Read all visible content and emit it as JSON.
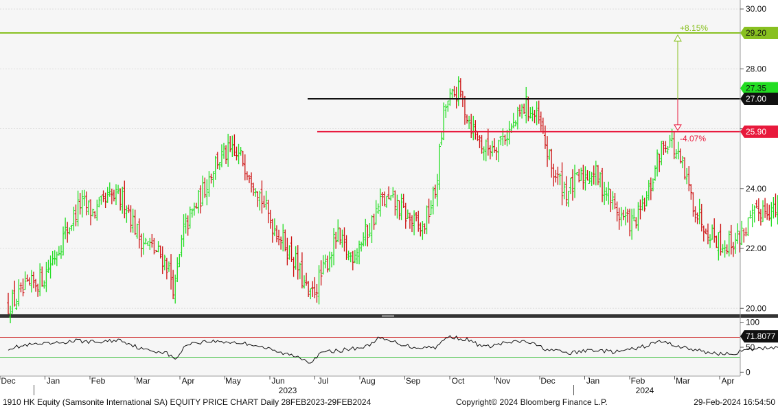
{
  "footer": {
    "left": "1910 HK Equity (Samsonite International SA) EQUITY PRICE CHART  Daily 28FEB2023-29FEB2024",
    "center": "Copyright© 2024 Bloomberg Finance L.P.",
    "right": "29-Feb-2024 16:54:50"
  },
  "colors": {
    "up": "#22dd22",
    "down": "#cc1111",
    "resistance": "#111111",
    "support": "#e8193c",
    "target": "#88c020",
    "rsi_line": "#111111",
    "rsi_upper": "#cc2222",
    "rsi_lower": "#33bb33"
  },
  "chart_data": [
    {
      "type": "candlestick",
      "title": "",
      "ylim": [
        19.8,
        30.3
      ],
      "yticks": [
        20,
        22,
        24,
        26,
        28,
        30
      ],
      "ytick_labels": [
        "20.00",
        "22.00",
        "24.00",
        "26.00",
        "28.00",
        "30.00"
      ],
      "x_month_labels": [
        "Dec",
        "Jan",
        "Feb",
        "Mar",
        "Apr",
        "May",
        "Jun",
        "Jul",
        "Aug",
        "Sep",
        "Oct",
        "Nov",
        "Dec",
        "Jan",
        "Feb",
        "Mar",
        "Apr"
      ],
      "x_year_labels": [
        "2023",
        "2024"
      ],
      "price_path": [
        {
          "m": 0.0,
          "p": 20.1
        },
        {
          "m": 0.4,
          "p": 20.6
        },
        {
          "m": 0.8,
          "p": 21.1
        },
        {
          "m": 1.2,
          "p": 22.3
        },
        {
          "m": 1.6,
          "p": 23.5
        },
        {
          "m": 1.9,
          "p": 23.2
        },
        {
          "m": 2.3,
          "p": 23.7
        },
        {
          "m": 2.6,
          "p": 23.6
        },
        {
          "m": 2.9,
          "p": 22.4
        },
        {
          "m": 3.2,
          "p": 22.0
        },
        {
          "m": 3.5,
          "p": 21.6
        },
        {
          "m": 3.7,
          "p": 20.6
        },
        {
          "m": 3.9,
          "p": 22.6
        },
        {
          "m": 4.3,
          "p": 23.8
        },
        {
          "m": 4.6,
          "p": 24.9
        },
        {
          "m": 4.9,
          "p": 25.2
        },
        {
          "m": 5.2,
          "p": 25.0
        },
        {
          "m": 5.5,
          "p": 24.2
        },
        {
          "m": 5.8,
          "p": 23.0
        },
        {
          "m": 6.1,
          "p": 22.3
        },
        {
          "m": 6.4,
          "p": 21.5
        },
        {
          "m": 6.7,
          "p": 20.3
        },
        {
          "m": 7.0,
          "p": 21.2
        },
        {
          "m": 7.3,
          "p": 22.4
        },
        {
          "m": 7.6,
          "p": 21.7
        },
        {
          "m": 8.0,
          "p": 22.6
        },
        {
          "m": 8.3,
          "p": 23.6
        },
        {
          "m": 8.6,
          "p": 23.5
        },
        {
          "m": 8.9,
          "p": 23.0
        },
        {
          "m": 9.2,
          "p": 22.6
        },
        {
          "m": 9.5,
          "p": 23.9
        },
        {
          "m": 9.7,
          "p": 26.7
        },
        {
          "m": 10.0,
          "p": 27.3
        },
        {
          "m": 10.3,
          "p": 26.1
        },
        {
          "m": 10.6,
          "p": 25.3
        },
        {
          "m": 10.9,
          "p": 25.6
        },
        {
          "m": 11.2,
          "p": 26.0
        },
        {
          "m": 11.5,
          "p": 26.8
        },
        {
          "m": 11.8,
          "p": 26.2
        },
        {
          "m": 12.1,
          "p": 24.6
        },
        {
          "m": 12.4,
          "p": 23.9
        },
        {
          "m": 12.7,
          "p": 24.3
        },
        {
          "m": 13.0,
          "p": 24.6
        },
        {
          "m": 13.3,
          "p": 23.9
        },
        {
          "m": 13.6,
          "p": 23.1
        },
        {
          "m": 13.9,
          "p": 22.8
        },
        {
          "m": 14.2,
          "p": 23.6
        },
        {
          "m": 14.5,
          "p": 25.3
        },
        {
          "m": 14.7,
          "p": 25.7
        },
        {
          "m": 15.0,
          "p": 24.6
        },
        {
          "m": 15.3,
          "p": 23.2
        },
        {
          "m": 15.6,
          "p": 22.6
        },
        {
          "m": 15.9,
          "p": 22.1
        },
        {
          "m": 16.2,
          "p": 22.3
        },
        {
          "m": 16.5,
          "p": 22.9
        },
        {
          "m": 16.8,
          "p": 23.4
        },
        {
          "m": 17.1,
          "p": 23.2
        },
        {
          "m": 17.4,
          "p": 23.7
        },
        {
          "m": 17.6,
          "p": 23.2
        },
        {
          "m": 17.85,
          "p": 27.35
        }
      ],
      "last_price": 27.35,
      "last_price_label": "27.35",
      "levels": [
        {
          "name": "target",
          "value": 29.2,
          "label": "29.20",
          "change_label": "+8.15%"
        },
        {
          "name": "resistance",
          "value": 27.0,
          "label": "27.00"
        },
        {
          "name": "support",
          "value": 25.9,
          "label": "25.90",
          "change_label": "-4.07%"
        }
      ]
    },
    {
      "type": "line",
      "title": "",
      "ylim": [
        -5,
        105
      ],
      "yticks": [
        0,
        50,
        100
      ],
      "ytick_labels": [
        "0",
        "50",
        "100"
      ],
      "upper_band": 70,
      "lower_band": 30,
      "last_value_label": "71.8077",
      "values_path": [
        {
          "m": 0.0,
          "v": 48
        },
        {
          "m": 0.5,
          "v": 55
        },
        {
          "m": 1.0,
          "v": 57
        },
        {
          "m": 1.5,
          "v": 63
        },
        {
          "m": 2.0,
          "v": 60
        },
        {
          "m": 2.5,
          "v": 65
        },
        {
          "m": 3.0,
          "v": 45
        },
        {
          "m": 3.5,
          "v": 40
        },
        {
          "m": 3.7,
          "v": 25
        },
        {
          "m": 4.0,
          "v": 58
        },
        {
          "m": 4.5,
          "v": 62
        },
        {
          "m": 5.0,
          "v": 60
        },
        {
          "m": 5.5,
          "v": 55
        },
        {
          "m": 6.0,
          "v": 40
        },
        {
          "m": 6.5,
          "v": 30
        },
        {
          "m": 6.7,
          "v": 20
        },
        {
          "m": 7.0,
          "v": 40
        },
        {
          "m": 7.5,
          "v": 45
        },
        {
          "m": 8.0,
          "v": 52
        },
        {
          "m": 8.2,
          "v": 68
        },
        {
          "m": 8.6,
          "v": 60
        },
        {
          "m": 9.0,
          "v": 50
        },
        {
          "m": 9.5,
          "v": 50
        },
        {
          "m": 9.8,
          "v": 72
        },
        {
          "m": 10.2,
          "v": 65
        },
        {
          "m": 10.6,
          "v": 50
        },
        {
          "m": 11.0,
          "v": 58
        },
        {
          "m": 11.5,
          "v": 62
        },
        {
          "m": 12.0,
          "v": 45
        },
        {
          "m": 12.5,
          "v": 38
        },
        {
          "m": 13.0,
          "v": 45
        },
        {
          "m": 13.5,
          "v": 40
        },
        {
          "m": 14.0,
          "v": 48
        },
        {
          "m": 14.5,
          "v": 62
        },
        {
          "m": 15.0,
          "v": 50
        },
        {
          "m": 15.5,
          "v": 40
        },
        {
          "m": 16.0,
          "v": 36
        },
        {
          "m": 16.5,
          "v": 45
        },
        {
          "m": 17.0,
          "v": 50
        },
        {
          "m": 17.5,
          "v": 55
        },
        {
          "m": 17.85,
          "v": 71.8
        }
      ]
    }
  ]
}
